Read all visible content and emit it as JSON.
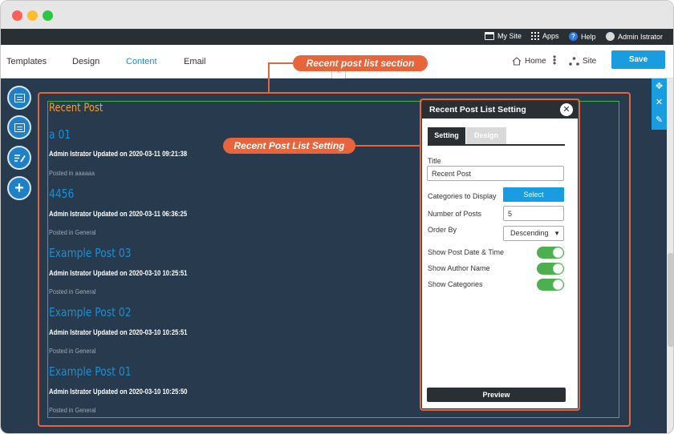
{
  "topbar": {
    "my_site": "My Site",
    "apps": "Apps",
    "help": "Help",
    "user": "Admin Istrator"
  },
  "nav": {
    "tabs": [
      {
        "label": "Templates"
      },
      {
        "label": "Design"
      },
      {
        "label": "Content"
      },
      {
        "label": "Email"
      }
    ],
    "active_tab": "Content",
    "home": "Home",
    "site": "Site",
    "save": "Save"
  },
  "callouts": {
    "section": "Recent post list section",
    "setting": "Recent Post List Setting"
  },
  "recent_posts": {
    "heading": "Recent Post",
    "posts": [
      {
        "title": "a 01",
        "meta": "Admin Istrator Updated on 2020-03-11 09:21:38",
        "category": "Posted in aaaaaa"
      },
      {
        "title": "4456",
        "meta": "Admin Istrator Updated on 2020-03-11 06:36:25",
        "category": "Posted in General"
      },
      {
        "title": "Example Post 03",
        "meta": "Admin Istrator Updated on 2020-03-10 10:25:51",
        "category": "Posted in General"
      },
      {
        "title": "Example Post 02",
        "meta": "Admin Istrator Updated on 2020-03-10 10:25:51",
        "category": "Posted in General"
      },
      {
        "title": "Example Post 01",
        "meta": "Admin Istrator Updated on 2020-03-10 10:25:50",
        "category": "Posted in General"
      }
    ]
  },
  "panel": {
    "title": "Recent Post List Setting",
    "close": "✕",
    "tabs": {
      "setting": "Setting",
      "design": "Design"
    },
    "title_label": "Title",
    "title_value": "Recent Post",
    "categories_label": "Categories to Display",
    "select_button": "Select",
    "num_posts_label": "Number of Posts",
    "num_posts_value": "5",
    "order_label": "Order By",
    "order_value": "Descending",
    "show_date_label": "Show Post Date & Time",
    "show_author_label": "Show Author Name",
    "show_categories_label": "Show Categories",
    "toggles": {
      "show_date": true,
      "show_author": true,
      "show_categories": true
    },
    "preview_button": "Preview"
  },
  "icons": {
    "calendar": "calendar-icon",
    "apps": "apps-grid-icon",
    "help": "help-icon",
    "avatar": "avatar-icon",
    "home": "home-icon",
    "sitemap": "sitemap-icon",
    "move": "move-icon",
    "close": "close-icon",
    "edit": "edit-icon",
    "add": "plus-icon"
  },
  "colors": {
    "accent": "#1a9ce0",
    "callout": "#e8643a",
    "canvas": "#283b4e",
    "heading": "#f0a030",
    "toggle_on": "#4caf50"
  }
}
